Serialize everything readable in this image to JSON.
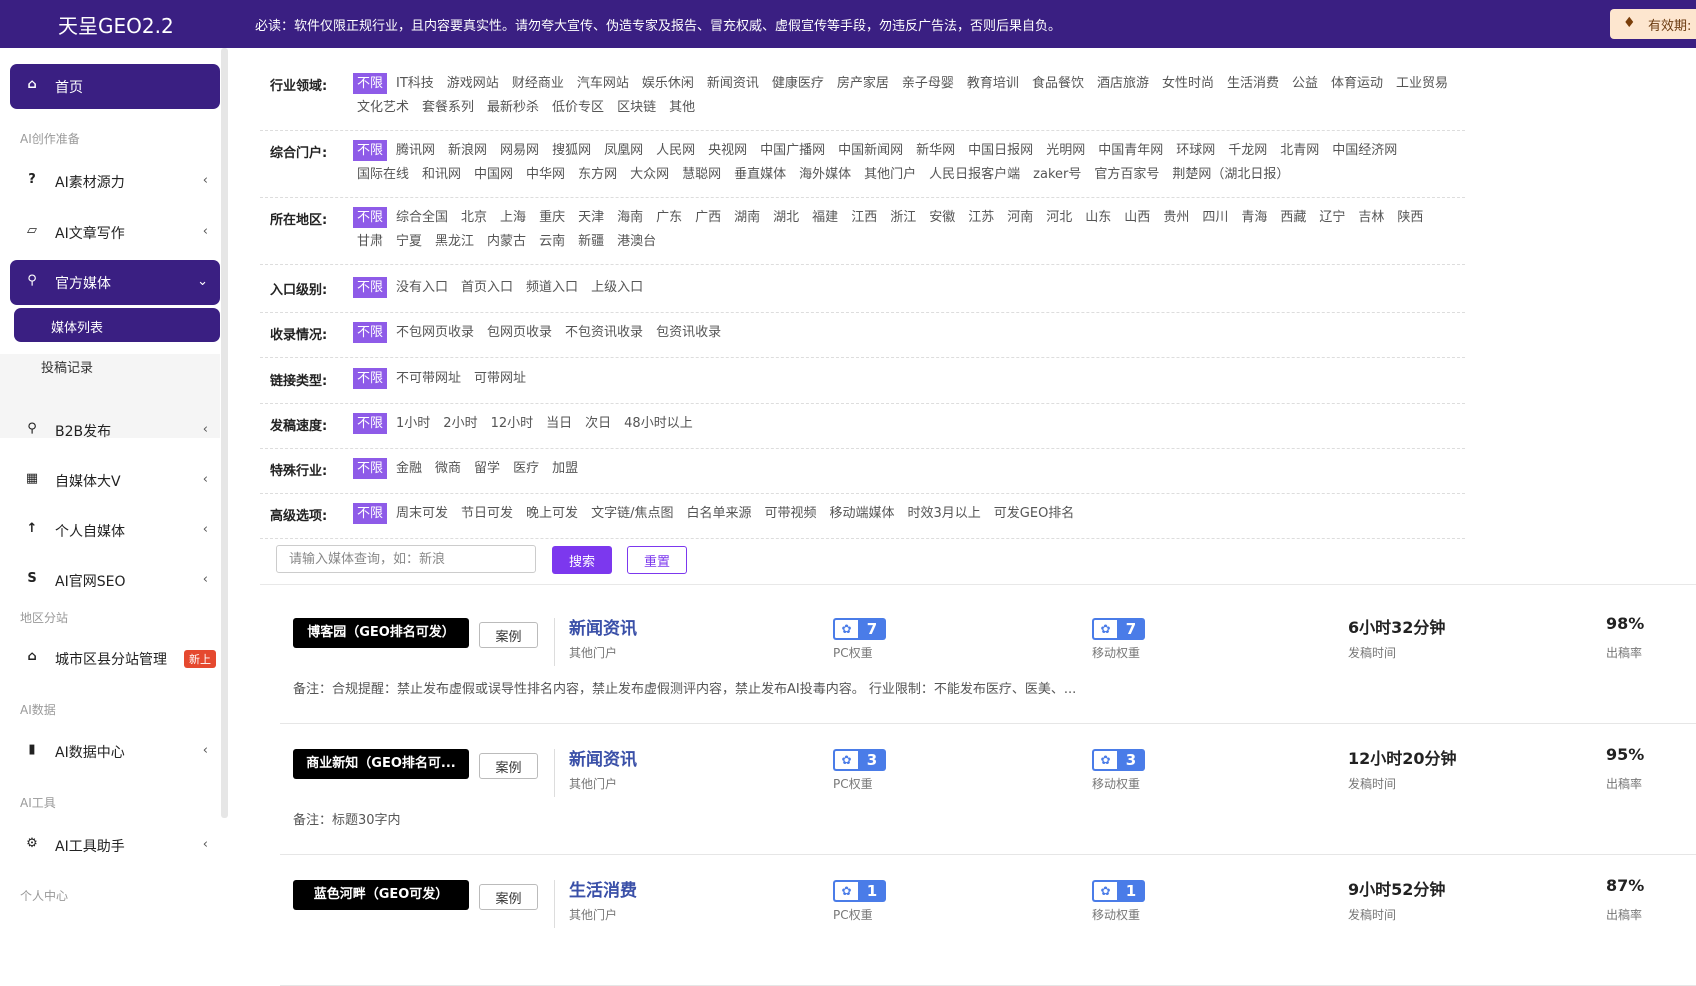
{
  "header": {
    "logo": "天呈GEO2.2",
    "notice": "必读：软件仅限正规行业，且内容要真实性。请勿夸大宣传、伪造专家及报告、冒充权威、虚假宣传等手段，勿违反广告法，否则后果自负。",
    "expiry": "有效期:"
  },
  "sidebar": {
    "home": "首页",
    "sec_prep": "AI创作准备",
    "ai_material": "AI素材源力",
    "ai_article": "AI文章写作",
    "official_media": "官方媒体",
    "media_list": "媒体列表",
    "submit_record": "投稿记录",
    "b2b": "B2B发布",
    "self_media_v": "自媒体大V",
    "personal_media": "个人自媒体",
    "ai_seo": "AI官网SEO",
    "sec_region": "地区分站",
    "city_station": "城市区县分站管理",
    "badge_new": "新上",
    "sec_data": "AI数据",
    "data_center": "AI数据中心",
    "sec_tools": "AI工具",
    "tool_helper": "AI工具助手",
    "sec_personal": "个人中心"
  },
  "filters": [
    {
      "label": "行业领域:",
      "options": [
        "不限",
        "IT科技",
        "游戏网站",
        "财经商业",
        "汽车网站",
        "娱乐休闲",
        "新闻资讯",
        "健康医疗",
        "房产家居",
        "亲子母婴",
        "教育培训",
        "食品餐饮",
        "酒店旅游",
        "女性时尚",
        "生活消费",
        "公益",
        "体育运动",
        "工业贸易",
        "文化艺术",
        "套餐系列",
        "最新秒杀",
        "低价专区",
        "区块链",
        "其他"
      ]
    },
    {
      "label": "综合门户:",
      "options": [
        "不限",
        "腾讯网",
        "新浪网",
        "网易网",
        "搜狐网",
        "凤凰网",
        "人民网",
        "央视网",
        "中国广播网",
        "中国新闻网",
        "新华网",
        "中国日报网",
        "光明网",
        "中国青年网",
        "环球网",
        "千龙网",
        "北青网",
        "中国经济网",
        "国际在线",
        "和讯网",
        "中国网",
        "中华网",
        "东方网",
        "大众网",
        "慧聪网",
        "垂直媒体",
        "海外媒体",
        "其他门户",
        "人民日报客户端",
        "zaker号",
        "官方百家号",
        "荆楚网（湖北日报）"
      ]
    },
    {
      "label": "所在地区:",
      "options": [
        "不限",
        "综合全国",
        "北京",
        "上海",
        "重庆",
        "天津",
        "海南",
        "广东",
        "广西",
        "湖南",
        "湖北",
        "福建",
        "江西",
        "浙江",
        "安徽",
        "江苏",
        "河南",
        "河北",
        "山东",
        "山西",
        "贵州",
        "四川",
        "青海",
        "西藏",
        "辽宁",
        "吉林",
        "陕西",
        "甘肃",
        "宁夏",
        "黑龙江",
        "内蒙古",
        "云南",
        "新疆",
        "港澳台"
      ]
    },
    {
      "label": "入口级别:",
      "options": [
        "不限",
        "没有入口",
        "首页入口",
        "频道入口",
        "上级入口"
      ]
    },
    {
      "label": "收录情况:",
      "options": [
        "不限",
        "不包网页收录",
        "包网页收录",
        "不包资讯收录",
        "包资讯收录"
      ]
    },
    {
      "label": "链接类型:",
      "options": [
        "不限",
        "不可带网址",
        "可带网址"
      ]
    },
    {
      "label": "发稿速度:",
      "options": [
        "不限",
        "1小时",
        "2小时",
        "12小时",
        "当日",
        "次日",
        "48小时以上"
      ]
    },
    {
      "label": "特殊行业:",
      "options": [
        "不限",
        "金融",
        "微商",
        "留学",
        "医疗",
        "加盟"
      ]
    },
    {
      "label": "高级选项:",
      "options": [
        "不限",
        "周末可发",
        "节日可发",
        "晚上可发",
        "文字链/焦点图",
        "白名单来源",
        "可带视频",
        "移动端媒体",
        "时效3月以上",
        "可发GEO排名"
      ]
    }
  ],
  "search": {
    "placeholder": "请输入媒体查询，如：新浪",
    "search_btn": "搜索",
    "reset_btn": "重置"
  },
  "media": [
    {
      "name": "博客园（GEO排名可发）",
      "case": "案例",
      "industry": "新闻资讯",
      "portal": "其他门户",
      "pc_weight": "7",
      "pc_label": "PC权重",
      "mobile_weight": "7",
      "mobile_label": "移动权重",
      "time": "6小时32分钟",
      "time_label": "发稿时间",
      "rate": "98%",
      "rate_label": "出稿率",
      "remark": "备注：合规提醒：禁止发布虚假或误导性排名内容，禁止发布虚假测评内容，禁止发布AI投毒内容。 行业限制：不能发布医疗、医美、..."
    },
    {
      "name": "商业新知（GEO排名可...",
      "case": "案例",
      "industry": "新闻资讯",
      "portal": "其他门户",
      "pc_weight": "3",
      "pc_label": "PC权重",
      "mobile_weight": "3",
      "mobile_label": "移动权重",
      "time": "12小时20分钟",
      "time_label": "发稿时间",
      "rate": "95%",
      "rate_label": "出稿率",
      "remark": "备注：标题30字内"
    },
    {
      "name": "蓝色河畔（GEO可发）",
      "case": "案例",
      "industry": "生活消费",
      "portal": "其他门户",
      "pc_weight": "1",
      "pc_label": "PC权重",
      "mobile_weight": "1",
      "mobile_label": "移动权重",
      "time": "9小时52分钟",
      "time_label": "发稿时间",
      "rate": "87%",
      "rate_label": "出稿率",
      "remark": ""
    }
  ]
}
